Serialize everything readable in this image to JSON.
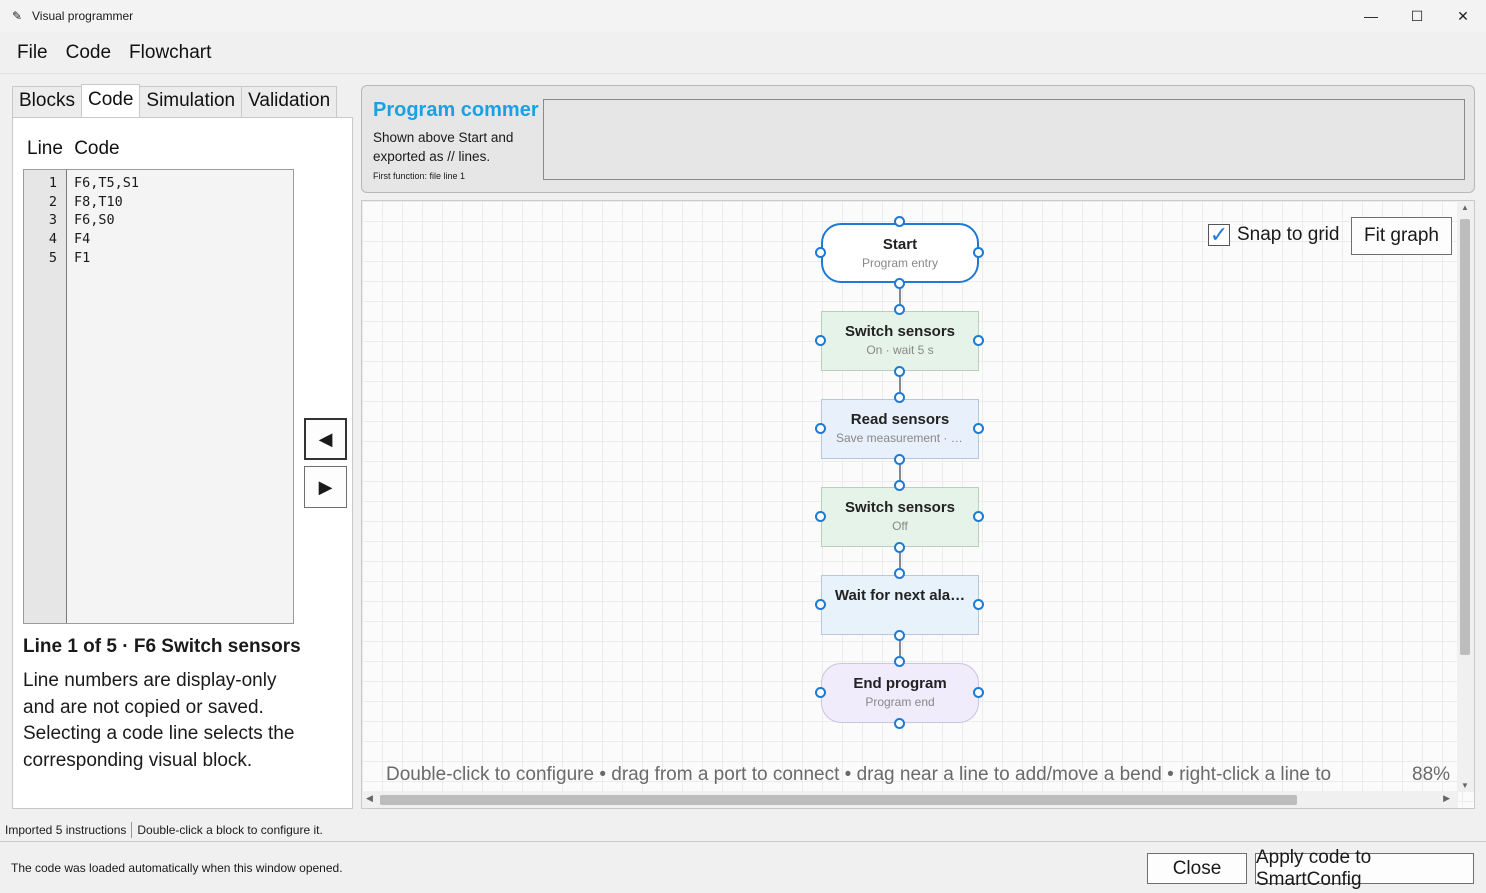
{
  "window": {
    "title": "Visual programmer",
    "app_icon": "wand-icon",
    "minimize": "—",
    "maximize": "☐",
    "close": "✕"
  },
  "menu": [
    "File",
    "Code",
    "Flowchart"
  ],
  "tabs": [
    "Blocks",
    "Code",
    "Simulation",
    "Validation"
  ],
  "active_tab": "Code",
  "code_panel": {
    "header_line": "Line",
    "header_code": "Code",
    "line_numbers": [
      "1",
      "2",
      "3",
      "4",
      "5"
    ],
    "lines": [
      "F6,T5,S1",
      "F8,T10",
      "F6,S0",
      "F4",
      "F1"
    ],
    "line_info": "Line 1 of 5 · F6 Switch sensors",
    "help_text": "Line numbers are display-only and are not copied or saved. Selecting a code line selects the corresponding visual block.",
    "prev_button": "◀",
    "next_button": "▶"
  },
  "comment": {
    "title": "Program commer",
    "description": "Shown above Start and exported as // lines.",
    "sub": "First function: file line 1",
    "value": ""
  },
  "canvas": {
    "snap_label": "Snap to grid",
    "snap_checked": true,
    "fit_button": "Fit graph",
    "hint": "Double-click to configure • drag from a port to connect • drag near a line to add/move a bend • right-click a line to",
    "zoom": "88%",
    "nodes": [
      {
        "title": "Start",
        "subtitle": "Program entry"
      },
      {
        "title": "Switch sensors",
        "subtitle": "On · wait 5 s"
      },
      {
        "title": "Read sensors",
        "subtitle": "Save measurement · 1…"
      },
      {
        "title": "Switch sensors",
        "subtitle": "Off"
      },
      {
        "title": "Wait for next ala…",
        "subtitle": ""
      },
      {
        "title": "End program",
        "subtitle": "Program end"
      }
    ]
  },
  "status": {
    "left": "Imported 5 instructions",
    "right": "Double-click a block to configure it."
  },
  "bottom": {
    "message": "The code was loaded automatically when this window opened.",
    "close": "Close",
    "apply": "Apply code to SmartConfig"
  },
  "colors": {
    "accent": "#1e7ad6",
    "comment_title": "#1ba1e2",
    "node_green": "#e6f3e9",
    "node_blue": "#e8f0fb",
    "node_purple": "#f0ecfb"
  }
}
